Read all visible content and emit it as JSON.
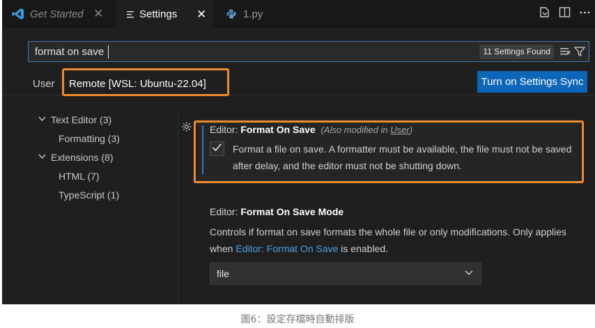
{
  "tabs": [
    {
      "label": "Get Started",
      "close": "✕"
    },
    {
      "label": "Settings",
      "close": "✕"
    },
    {
      "label": "1.py"
    }
  ],
  "search": {
    "value": "format on save",
    "results_badge": "11 Settings Found"
  },
  "scope": {
    "user": "User",
    "remote": "Remote [WSL: Ubuntu-22.04]",
    "sync_button": "Turn on Settings Sync"
  },
  "tree": [
    {
      "label": "Text Editor (3)",
      "expanded": true
    },
    {
      "label": "Formatting (3)"
    },
    {
      "label": "Extensions (8)",
      "expanded": true
    },
    {
      "label": "HTML (7)"
    },
    {
      "label": "TypeScript (1)"
    }
  ],
  "setting1": {
    "prefix": "Editor: ",
    "name": "Format On Save",
    "modified_open": "(Also modified in ",
    "modified_link": "User",
    "modified_close": ")",
    "checked": true,
    "description": "Format a file on save. A formatter must be available, the file must not be saved after delay, and the editor must not be shutting down."
  },
  "setting2": {
    "prefix": "Editor: ",
    "name": "Format On Save Mode",
    "desc_part1": "Controls if format on save formats the whole file or only modifications. Only applies when ",
    "desc_link": "Editor: Format On Save",
    "desc_part2": " is enabled.",
    "value": "file"
  },
  "caption": "圖6：設定存檔時自動排版",
  "colors": {
    "accent": "#0d66b8",
    "highlight": "#f18a2e",
    "link": "#4aa1e8"
  }
}
